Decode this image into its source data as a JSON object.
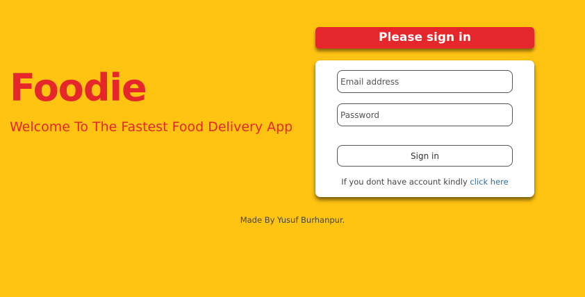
{
  "brand": {
    "title": "Foodie",
    "tagline": "Welcome To The Fastest Food Delivery App"
  },
  "signin": {
    "header": "Please sign in",
    "email_placeholder": "Email address",
    "password_placeholder": "Password",
    "button_label": "Sign in",
    "register_prompt": "If you dont have account kindly ",
    "register_link": "click here"
  },
  "footer": {
    "credit": "Made By Yusuf Burhanpur."
  },
  "colors": {
    "background": "#FFC312",
    "accent": "#E5262B",
    "link": "#2F6FA8"
  }
}
